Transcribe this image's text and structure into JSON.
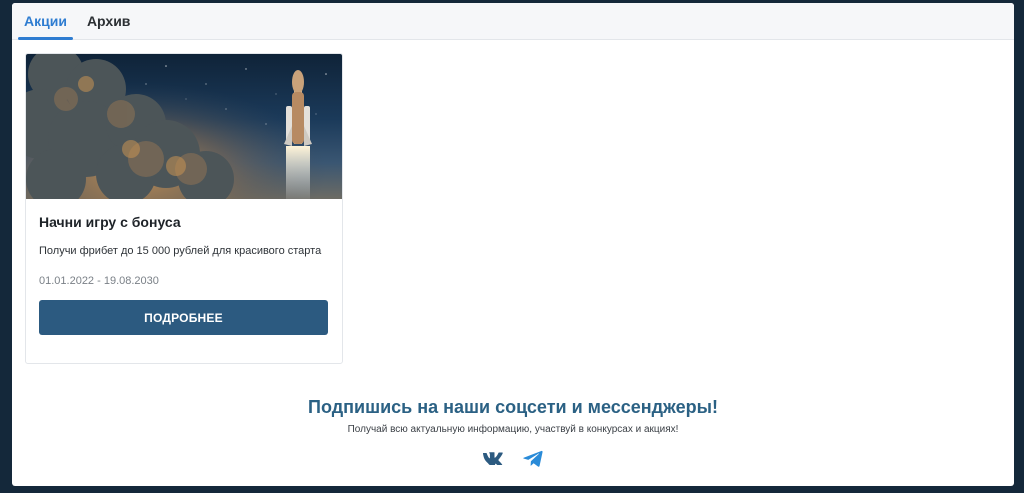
{
  "tabs": [
    {
      "label": "Акции",
      "active": true
    },
    {
      "label": "Архив",
      "active": false
    }
  ],
  "promo": {
    "title": "Начни игру с бонуса",
    "description": "Получи фрибет до 15 000 рублей для красивого старта",
    "dates": "01.01.2022 - 19.08.2030",
    "button_label": "ПОДРОБНЕЕ",
    "image": "rocket-launch-illustration"
  },
  "subscribe": {
    "title": "Подпишись на наши соцсети и мессенджеры!",
    "text": "Получай всю актуальную информацию, участвуй в конкурсах и акциях!",
    "icons": [
      "vk-icon",
      "telegram-icon"
    ]
  },
  "colors": {
    "page_background": "#14283a",
    "accent": "#2f7dd1",
    "button": "#2c5a80",
    "subscribe_title": "#2b6184",
    "social_icons": "#2c5a80",
    "telegram": "#2a8bd8"
  }
}
